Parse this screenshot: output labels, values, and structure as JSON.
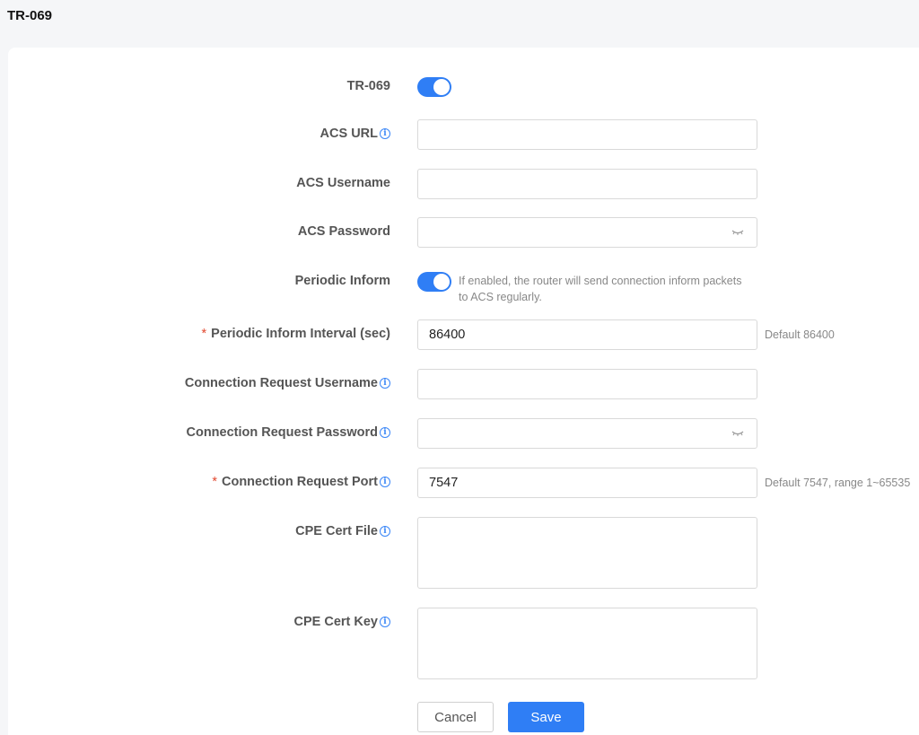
{
  "page": {
    "title": "TR-069"
  },
  "fields": {
    "tr069": {
      "label": "TR-069",
      "enabled": true
    },
    "acs_url": {
      "label": "ACS URL",
      "value": ""
    },
    "acs_username": {
      "label": "ACS Username",
      "value": ""
    },
    "acs_password": {
      "label": "ACS Password",
      "value": ""
    },
    "periodic_inform": {
      "label": "Periodic Inform",
      "enabled": true,
      "help": "If enabled, the router will send connection inform packets to ACS regularly."
    },
    "periodic_interval": {
      "label": "Periodic Inform Interval (sec)",
      "value": "86400",
      "hint": "Default 86400",
      "required_mark": "*"
    },
    "conn_req_username": {
      "label": "Connection Request Username",
      "value": ""
    },
    "conn_req_password": {
      "label": "Connection Request Password",
      "value": ""
    },
    "conn_req_port": {
      "label": "Connection Request Port",
      "value": "7547",
      "hint": "Default 7547, range 1~65535",
      "required_mark": "*"
    },
    "cpe_cert_file": {
      "label": "CPE Cert File",
      "value": ""
    },
    "cpe_cert_key": {
      "label": "CPE Cert Key",
      "value": ""
    }
  },
  "icons": {
    "info": "info-icon",
    "eye": "eye-closed-icon"
  },
  "buttons": {
    "cancel": "Cancel",
    "save": "Save"
  },
  "colors": {
    "accent": "#2f7ef5",
    "required": "#e2482f"
  }
}
